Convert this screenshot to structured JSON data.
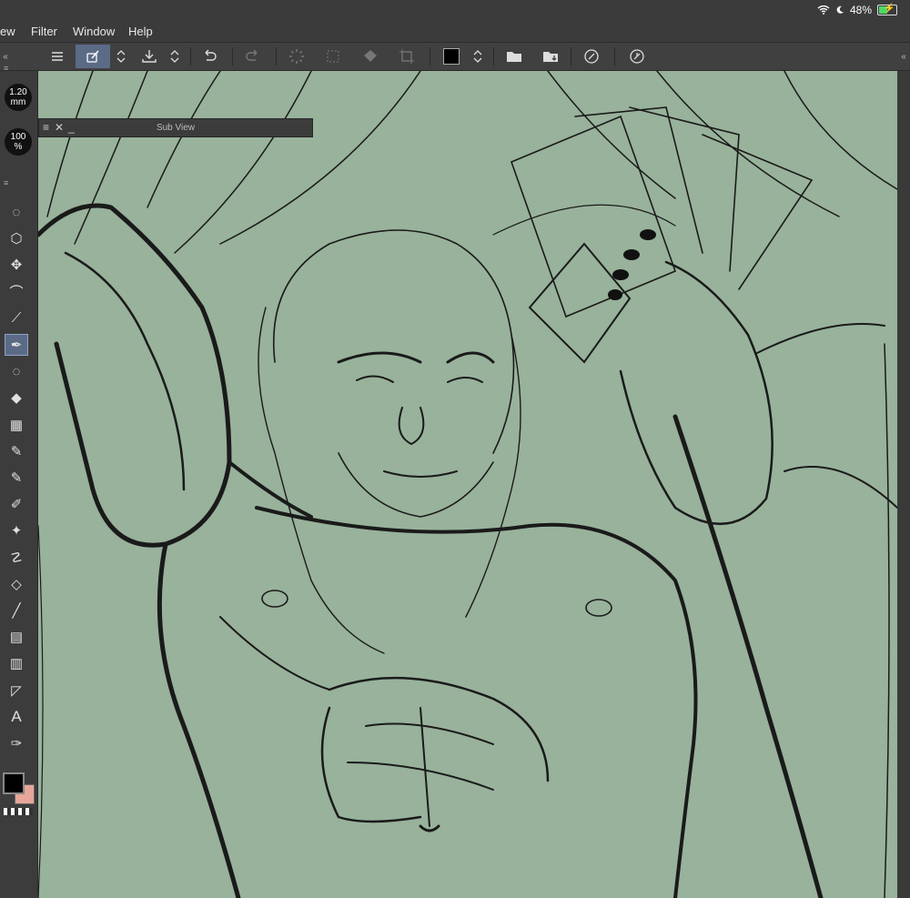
{
  "menubar": {
    "items": [
      "ew",
      "Filter",
      "Window",
      "Help"
    ]
  },
  "status": {
    "battery_percent": "48%",
    "battery_level": 0.48,
    "icons": [
      "wifi-icon",
      "moon-icon",
      "battery-icon"
    ]
  },
  "toolbar": {
    "icons": [
      "menu-icon",
      "brush-layer-icon",
      "up-down-icon",
      "import-icon",
      "up-down-icon",
      "undo-icon",
      "redo-icon",
      "loading-icon",
      "transform-icon",
      "fill-icon",
      "crop-icon",
      "color-swatch",
      "up-down-icon",
      "open-folder-icon",
      "save-folder-icon",
      "reference-icon",
      "reference-alt-icon"
    ],
    "color_swatch": "#000000",
    "accent": "#5b6b86"
  },
  "rail": {
    "brush_size": "1.20",
    "brush_unit": "mm",
    "opacity": "100",
    "opacity_unit": "%",
    "tools": [
      "lasso-icon",
      "cube-icon",
      "move-icon",
      "lasso-selection-icon",
      "eyedropper-icon",
      "pen-icon",
      "lasso-fill-icon",
      "airbrush-icon",
      "grid-icon",
      "pen-nib-icon",
      "pencil-icon",
      "marker-icon",
      "sparkle-icon",
      "blend-icon",
      "eraser-icon",
      "line-icon",
      "gradient-icon",
      "layer-icon",
      "ruler-icon",
      "text-icon",
      "correction-icon"
    ],
    "main_color": "#000000",
    "sub_color": "#e8a69a"
  },
  "subview": {
    "title": "Sub View"
  },
  "canvas": {
    "background": "#98b29b"
  }
}
